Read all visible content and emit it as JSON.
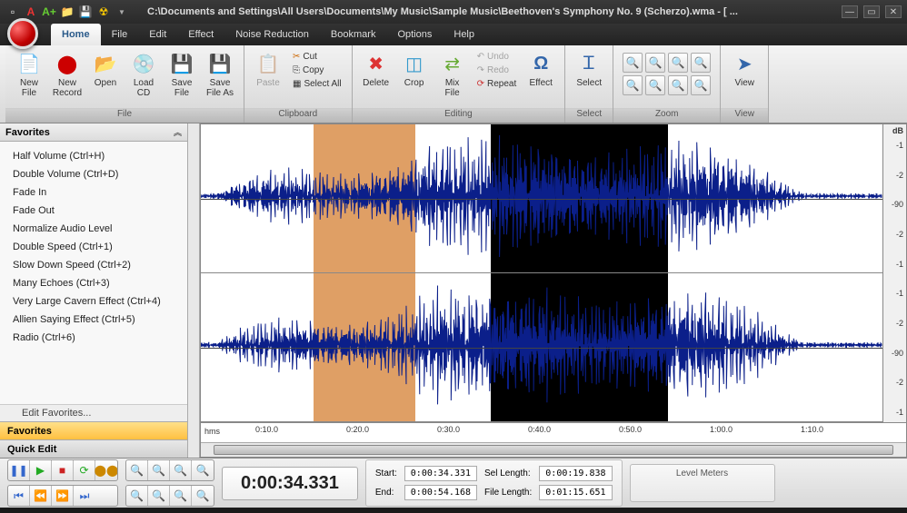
{
  "titlebar": {
    "title": "C:\\Documents and Settings\\All Users\\Documents\\My Music\\Sample Music\\Beethoven's Symphony No. 9 (Scherzo).wma - [ ..."
  },
  "menu": {
    "tabs": [
      "Home",
      "File",
      "Edit",
      "Effect",
      "Noise Reduction",
      "Bookmark",
      "Options",
      "Help"
    ],
    "active": 0
  },
  "ribbon": {
    "file": {
      "label": "File",
      "new_file": "New\nFile",
      "new_record": "New\nRecord",
      "open": "Open",
      "load_cd": "Load\nCD",
      "save_file": "Save\nFile",
      "save_as": "Save\nFile As"
    },
    "clipboard": {
      "label": "Clipboard",
      "paste": "Paste",
      "cut": "Cut",
      "copy": "Copy",
      "select_all": "Select All"
    },
    "editing": {
      "label": "Editing",
      "delete": "Delete",
      "crop": "Crop",
      "mix_file": "Mix\nFile",
      "undo": "Undo",
      "redo": "Redo",
      "repeat": "Repeat",
      "effect": "Effect"
    },
    "select": {
      "label": "Select",
      "select": "Select"
    },
    "zoom": {
      "label": "Zoom"
    },
    "view": {
      "label": "View",
      "view": "View"
    }
  },
  "sidebar": {
    "header": "Favorites",
    "items": [
      "Half Volume (Ctrl+H)",
      "Double Volume (Ctrl+D)",
      "Fade In",
      "Fade Out",
      "Normalize Audio Level",
      "Double Speed (Ctrl+1)",
      "Slow Down Speed (Ctrl+2)",
      "Many Echoes (Ctrl+3)",
      "Very Large Cavern Effect (Ctrl+4)",
      "Allien Saying Effect (Ctrl+5)",
      "Radio (Ctrl+6)"
    ],
    "edit_favorites": "Edit Favorites...",
    "tab_fav": "Favorites",
    "tab_quick": "Quick Edit"
  },
  "timeline": {
    "hms": "hms",
    "ticks": [
      "0:10.0",
      "0:20.0",
      "0:30.0",
      "0:40.0",
      "0:50.0",
      "1:00.0",
      "1:10.0"
    ]
  },
  "db": {
    "label": "dB",
    "marks": [
      "-1",
      "-2",
      "-90",
      "-2",
      "-1",
      "-1",
      "-2",
      "-90",
      "-2",
      "-1"
    ]
  },
  "transport": {
    "time": "0:00:34.331",
    "start_lbl": "Start:",
    "start_val": "0:00:34.331",
    "end_lbl": "End:",
    "end_val": "0:00:54.168",
    "sel_lbl": "Sel Length:",
    "sel_val": "0:00:19.838",
    "file_lbl": "File Length:",
    "file_val": "0:01:15.651",
    "meters": "Level Meters"
  },
  "selections": {
    "orange": {
      "left_pct": 16.5,
      "width_pct": 15.0
    },
    "black": {
      "left_pct": 42.5,
      "width_pct": 26.0
    }
  }
}
